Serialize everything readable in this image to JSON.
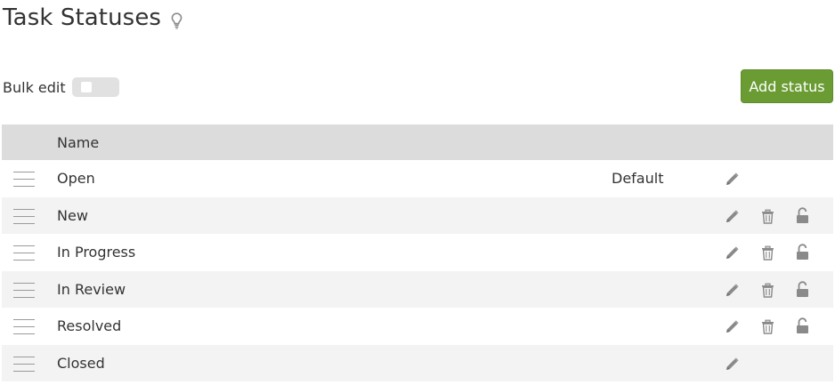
{
  "header": {
    "title": "Task Statuses",
    "help_icon": "lightbulb-icon"
  },
  "toolbar": {
    "bulk_edit_label": "Bulk edit",
    "bulk_edit_enabled": false,
    "add_status_label": "Add status"
  },
  "table": {
    "columns": [
      "Name"
    ],
    "rows": [
      {
        "name": "Open",
        "default_label": "Default",
        "editable": true,
        "deletable": false,
        "lockable": false
      },
      {
        "name": "New",
        "default_label": "",
        "editable": true,
        "deletable": true,
        "lockable": true
      },
      {
        "name": "In Progress",
        "default_label": "",
        "editable": true,
        "deletable": true,
        "lockable": true
      },
      {
        "name": "In Review",
        "default_label": "",
        "editable": true,
        "deletable": true,
        "lockable": true
      },
      {
        "name": "Resolved",
        "default_label": "",
        "editable": true,
        "deletable": true,
        "lockable": true
      },
      {
        "name": "Closed",
        "default_label": "",
        "editable": true,
        "deletable": false,
        "lockable": false
      }
    ]
  },
  "colors": {
    "accent_button": "#6a9c33",
    "header_bg": "#dcdcdc",
    "row_alt_bg": "#f3f3f3",
    "icon_gray": "#8a8a8a"
  },
  "icons": {
    "drag": "drag-handle-icon",
    "edit": "pencil-icon",
    "delete": "trash-icon",
    "lock": "unlock-icon"
  }
}
